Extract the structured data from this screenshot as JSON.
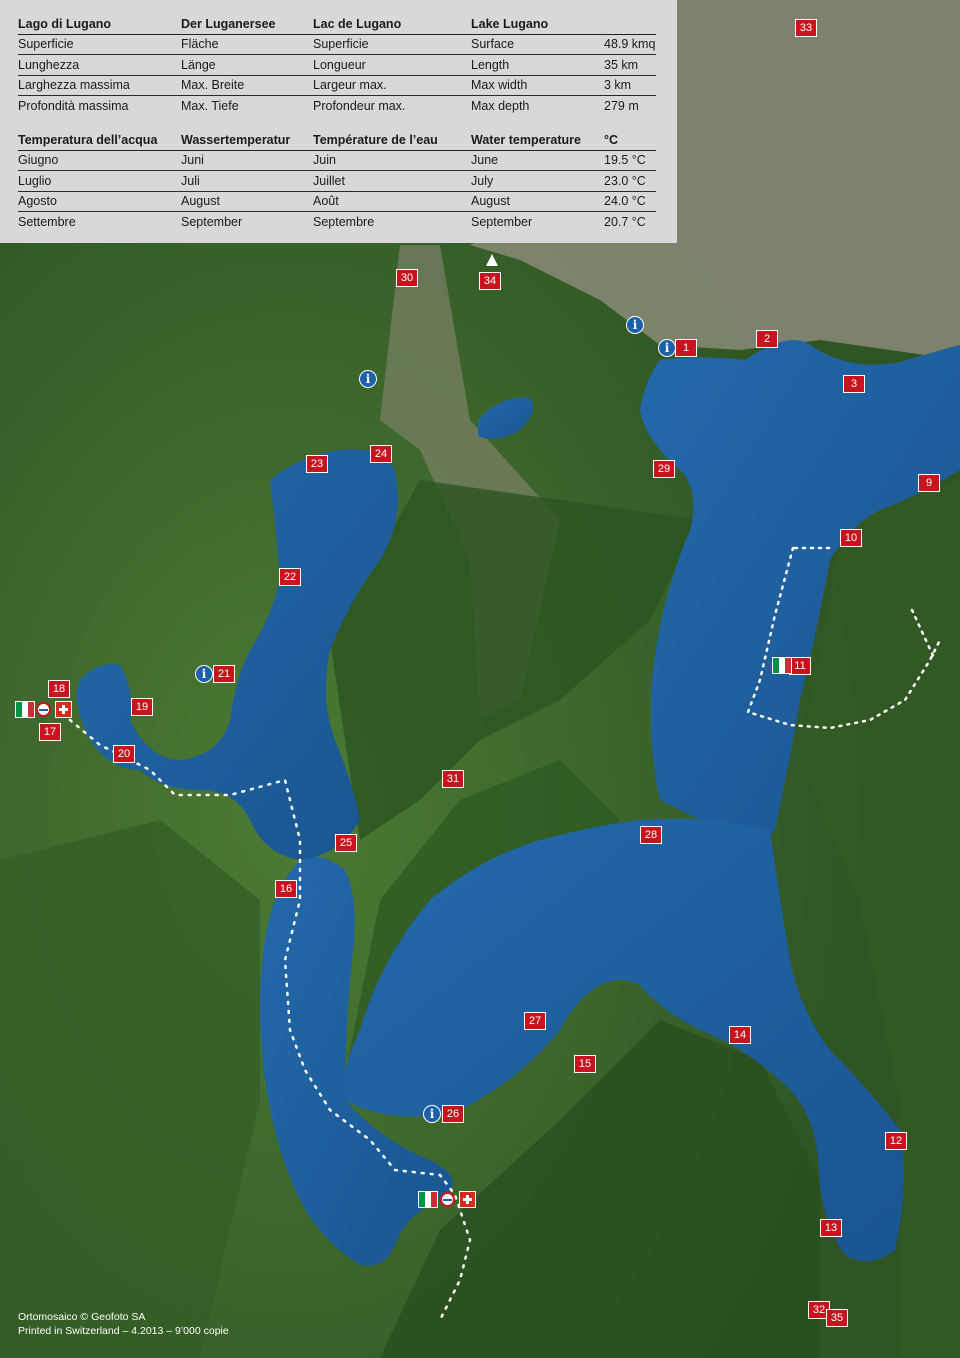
{
  "table_main": {
    "header": [
      "Lago di Lugano",
      "Der Luganersee",
      "Lac de Lugano",
      "Lake Lugano",
      ""
    ],
    "rows": [
      [
        "Superficie",
        "Fläche",
        "Superficie",
        "Surface",
        "48.9 kmq"
      ],
      [
        "Lunghezza",
        "Länge",
        "Longueur",
        "Length",
        "35 km"
      ],
      [
        "Larghezza massima",
        "Max. Breite",
        "Largeur max.",
        "Max width",
        "3 km"
      ],
      [
        "Profondità massima",
        "Max. Tiefe",
        "Profondeur max.",
        "Max depth",
        "279 m"
      ]
    ]
  },
  "table_temp": {
    "header": [
      "Temperatura dell’acqua",
      "Wassertemperatur",
      "Température de l’eau",
      "Water temperature",
      "°C"
    ],
    "rows": [
      [
        "Giugno",
        "Juni",
        "Juin",
        "June",
        "19.5 °C"
      ],
      [
        "Luglio",
        "Juli",
        "Juillet",
        "July",
        "23.0 °C"
      ],
      [
        "Agosto",
        "August",
        "Août",
        "August",
        "24.0 °C"
      ],
      [
        "Settembre",
        "September",
        "Septembre",
        "September",
        "20.7 °C"
      ]
    ]
  },
  "markers": [
    "33",
    "30",
    "34",
    "1",
    "2",
    "3",
    "23",
    "24",
    "29",
    "9",
    "10",
    "22",
    "11",
    "21",
    "18",
    "19",
    "17",
    "20",
    "31",
    "25",
    "28",
    "16",
    "27",
    "14",
    "15",
    "26",
    "12",
    "13",
    "32",
    "35"
  ],
  "credits": {
    "line1": "Ortomosaico © Geofoto SA",
    "line2": "Printed in Switzerland – 4.2013 – 9’000 copie"
  },
  "icons": [
    "info-icon",
    "italian-flag-icon",
    "swiss-flag-icon",
    "customs-icon",
    "north-arrow-icon"
  ],
  "colors": {
    "lake": "#1f5e9e",
    "land": "#3f6a2c",
    "marker": "#c8141e",
    "info": "#1d5fa8",
    "panel": "#d6d8da"
  }
}
